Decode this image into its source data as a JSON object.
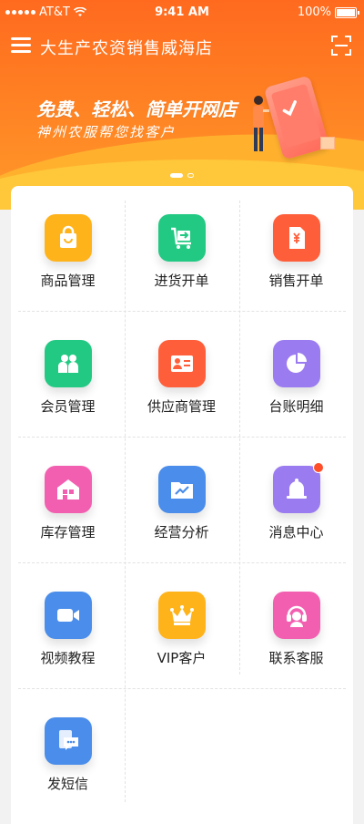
{
  "status_bar": {
    "carrier": "AT&T",
    "time": "9:41 AM",
    "battery": "100%"
  },
  "navbar": {
    "title": "大生产农资销售威海店"
  },
  "banner": {
    "headline": "免费、轻松、简单开网店",
    "subline": "神州农服帮您找客户"
  },
  "colors": {
    "header": "#ff6a1f",
    "yellow": "#ffb31a",
    "green": "#22c983",
    "red_orange": "#ff5e3a",
    "purple": "#9b7bf0",
    "pink": "#f35fb0",
    "blue": "#4a8dea",
    "notify": "#ff4f2a"
  },
  "menu": {
    "items": [
      {
        "label": "商品管理",
        "icon": "shopping-bag-icon",
        "color": "yellow"
      },
      {
        "label": "进货开单",
        "icon": "cart-arrow-icon",
        "color": "green"
      },
      {
        "label": "销售开单",
        "icon": "yen-document-icon",
        "color": "red_orange"
      },
      {
        "label": "会员管理",
        "icon": "members-icon",
        "color": "green"
      },
      {
        "label": "供应商管理",
        "icon": "supplier-card-icon",
        "color": "red_orange"
      },
      {
        "label": "台账明细",
        "icon": "pie-chart-icon",
        "color": "purple"
      },
      {
        "label": "库存管理",
        "icon": "warehouse-icon",
        "color": "pink"
      },
      {
        "label": "经营分析",
        "icon": "trend-folder-icon",
        "color": "blue"
      },
      {
        "label": "消息中心",
        "icon": "bell-icon",
        "color": "purple",
        "has_notification": true
      },
      {
        "label": "视频教程",
        "icon": "video-camera-icon",
        "color": "blue"
      },
      {
        "label": "VIP客户",
        "icon": "crown-icon",
        "color": "yellow"
      },
      {
        "label": "联系客服",
        "icon": "headset-icon",
        "color": "pink"
      },
      {
        "label": "发短信",
        "icon": "message-icon",
        "color": "blue"
      }
    ]
  }
}
